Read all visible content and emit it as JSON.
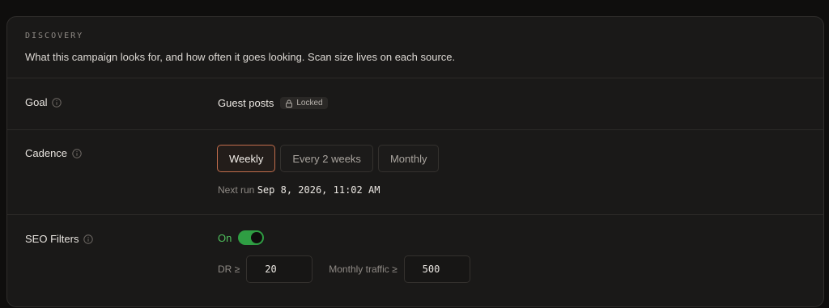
{
  "section": {
    "eyebrow": "DISCOVERY",
    "subtitle": "What this campaign looks for, and how often it goes looking. Scan size lives on each source."
  },
  "goal": {
    "label": "Goal",
    "value": "Guest posts",
    "badge": "Locked"
  },
  "cadence": {
    "label": "Cadence",
    "options": [
      "Weekly",
      "Every 2 weeks",
      "Monthly"
    ],
    "selected": "Weekly",
    "next_run_label": "Next run",
    "next_run_value": "Sep 8, 2026, 11:02 AM"
  },
  "seo_filters": {
    "label": "SEO Filters",
    "toggle_label": "On",
    "toggle_on": true,
    "dr_label": "DR ≥",
    "dr_value": "20",
    "traffic_label": "Monthly traffic ≥",
    "traffic_value": "500"
  },
  "colors": {
    "accent": "#c26d4c",
    "toggle_green": "#2f9e43"
  }
}
